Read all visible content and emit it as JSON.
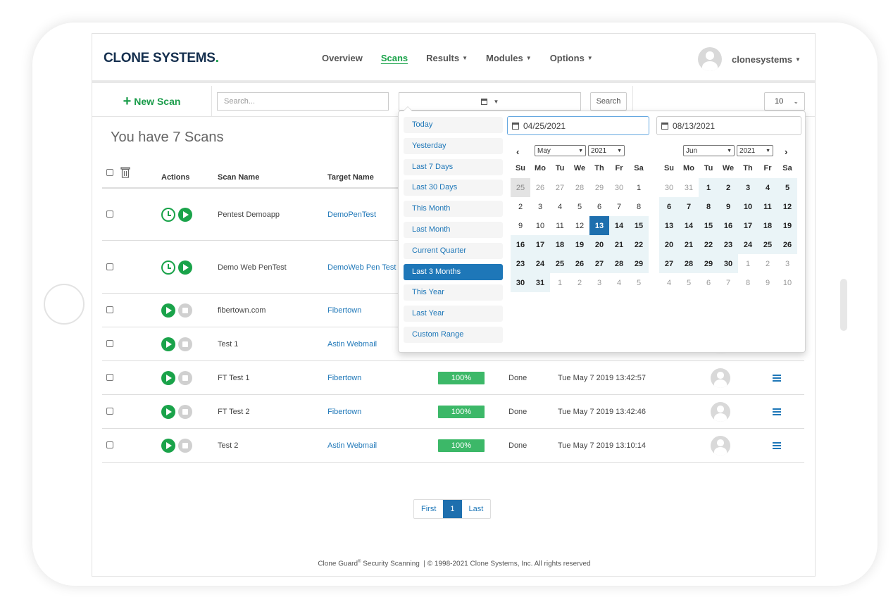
{
  "brand": {
    "name": "CLONE SYSTEMS",
    "dot": "."
  },
  "nav": [
    {
      "label": "Overview",
      "dropdown": false,
      "active": false
    },
    {
      "label": "Scans",
      "dropdown": false,
      "active": true
    },
    {
      "label": "Results",
      "dropdown": true,
      "active": false
    },
    {
      "label": "Modules",
      "dropdown": true,
      "active": false
    },
    {
      "label": "Options",
      "dropdown": true,
      "active": false
    }
  ],
  "user": {
    "name": "clonesystems"
  },
  "toolbar": {
    "new_scan_label": "New Scan",
    "search_placeholder": "Search...",
    "search_button": "Search",
    "page_size": "10"
  },
  "scan_count_text": "You have 7 Scans",
  "table": {
    "headers": {
      "actions": "Actions",
      "scan_name": "Scan Name",
      "target_name": "Target Name"
    },
    "rows": [
      {
        "scan_name": "Pentest Demoapp",
        "target": "DemoPenTest",
        "scheduled": true,
        "progress": "",
        "status": "",
        "date": ""
      },
      {
        "scan_name": "Demo Web PenTest",
        "target": "DemoWeb Pen Test",
        "scheduled": true,
        "progress": "",
        "status": "",
        "date": ""
      },
      {
        "scan_name": "fibertown.com",
        "target": "Fibertown",
        "scheduled": false,
        "progress": "",
        "status": "",
        "date": ""
      },
      {
        "scan_name": "Test 1",
        "target": "Astin Webmail",
        "scheduled": false,
        "progress": "",
        "status": "",
        "date": ""
      },
      {
        "scan_name": "FT Test 1",
        "target": "Fibertown",
        "scheduled": false,
        "progress": "100%",
        "status": "Done",
        "date": "Tue May 7 2019 13:42:57"
      },
      {
        "scan_name": "FT Test 2",
        "target": "Fibertown",
        "scheduled": false,
        "progress": "100%",
        "status": "Done",
        "date": "Tue May 7 2019 13:42:46"
      },
      {
        "scan_name": "Test 2",
        "target": "Astin Webmail",
        "scheduled": false,
        "progress": "100%",
        "status": "Done",
        "date": "Tue May 7 2019 13:10:14"
      }
    ]
  },
  "pagination": {
    "first": "First",
    "current": "1",
    "last": "Last"
  },
  "footer": {
    "product": "Clone Guard",
    "mark": "®",
    "text": " Security Scanning  | © 1998-2021 Clone Systems, Inc. All rights reserved"
  },
  "date_picker": {
    "ranges": [
      "Today",
      "Yesterday",
      "Last 7 Days",
      "Last 30 Days",
      "This Month",
      "Last Month",
      "Current Quarter",
      "Last 3 Months",
      "This Year",
      "Last Year",
      "Custom Range"
    ],
    "active_range": "Last 3 Months",
    "start_date": "04/25/2021",
    "end_date": "08/13/2021",
    "weekdays": [
      "Su",
      "Mo",
      "Tu",
      "We",
      "Th",
      "Fr",
      "Sa"
    ],
    "left_month": {
      "month": "May",
      "year": "2021"
    },
    "right_month": {
      "month": "Jun",
      "year": "2021"
    },
    "left_days": [
      [
        "25",
        "today"
      ],
      [
        "26",
        "off"
      ],
      [
        "27",
        "off"
      ],
      [
        "28",
        "off"
      ],
      [
        "29",
        "off"
      ],
      [
        "30",
        "off"
      ],
      [
        "1",
        ""
      ],
      [
        "2",
        ""
      ],
      [
        "3",
        ""
      ],
      [
        "4",
        ""
      ],
      [
        "5",
        ""
      ],
      [
        "6",
        ""
      ],
      [
        "7",
        ""
      ],
      [
        "8",
        ""
      ],
      [
        "9",
        ""
      ],
      [
        "10",
        ""
      ],
      [
        "11",
        ""
      ],
      [
        "12",
        ""
      ],
      [
        "13",
        "start"
      ],
      [
        "14",
        "inr"
      ],
      [
        "15",
        "inr"
      ],
      [
        "16",
        "inr"
      ],
      [
        "17",
        "inr"
      ],
      [
        "18",
        "inr"
      ],
      [
        "19",
        "inr"
      ],
      [
        "20",
        "inr"
      ],
      [
        "21",
        "inr"
      ],
      [
        "22",
        "inr"
      ],
      [
        "23",
        "inr"
      ],
      [
        "24",
        "inr"
      ],
      [
        "25",
        "inr"
      ],
      [
        "26",
        "inr"
      ],
      [
        "27",
        "inr"
      ],
      [
        "28",
        "inr"
      ],
      [
        "29",
        "inr"
      ],
      [
        "30",
        "inr"
      ],
      [
        "31",
        "inr"
      ],
      [
        "1",
        "off"
      ],
      [
        "2",
        "off"
      ],
      [
        "3",
        "off"
      ],
      [
        "4",
        "off"
      ],
      [
        "5",
        "off"
      ]
    ],
    "right_days": [
      [
        "30",
        "off"
      ],
      [
        "31",
        "off"
      ],
      [
        "1",
        "inr"
      ],
      [
        "2",
        "inr"
      ],
      [
        "3",
        "inr"
      ],
      [
        "4",
        "inr"
      ],
      [
        "5",
        "inr"
      ],
      [
        "6",
        "inr"
      ],
      [
        "7",
        "inr"
      ],
      [
        "8",
        "inr"
      ],
      [
        "9",
        "inr"
      ],
      [
        "10",
        "inr"
      ],
      [
        "11",
        "inr"
      ],
      [
        "12",
        "inr"
      ],
      [
        "13",
        "inr"
      ],
      [
        "14",
        "inr"
      ],
      [
        "15",
        "inr"
      ],
      [
        "16",
        "inr"
      ],
      [
        "17",
        "inr"
      ],
      [
        "18",
        "inr"
      ],
      [
        "19",
        "inr"
      ],
      [
        "20",
        "inr"
      ],
      [
        "21",
        "inr"
      ],
      [
        "22",
        "inr"
      ],
      [
        "23",
        "inr"
      ],
      [
        "24",
        "inr"
      ],
      [
        "25",
        "inr"
      ],
      [
        "26",
        "inr"
      ],
      [
        "27",
        "inr"
      ],
      [
        "28",
        "inr"
      ],
      [
        "29",
        "inr"
      ],
      [
        "30",
        "inr"
      ],
      [
        "1",
        "off"
      ],
      [
        "2",
        "off"
      ],
      [
        "3",
        "off"
      ],
      [
        "4",
        "off"
      ],
      [
        "5",
        "off"
      ],
      [
        "6",
        "off"
      ],
      [
        "7",
        "off"
      ],
      [
        "8",
        "off"
      ],
      [
        "9",
        "off"
      ],
      [
        "10",
        "off"
      ]
    ]
  },
  "colors": {
    "brand_green": "#1aa34a",
    "link_blue": "#1e77b8",
    "progress_green": "#3cb868",
    "navy": "#16304f"
  },
  "icons": [
    "trash-icon",
    "clock-icon",
    "play-icon",
    "stop-icon",
    "calendar-icon",
    "menu-icon",
    "avatar",
    "chevron-left-icon",
    "chevron-right-icon"
  ]
}
